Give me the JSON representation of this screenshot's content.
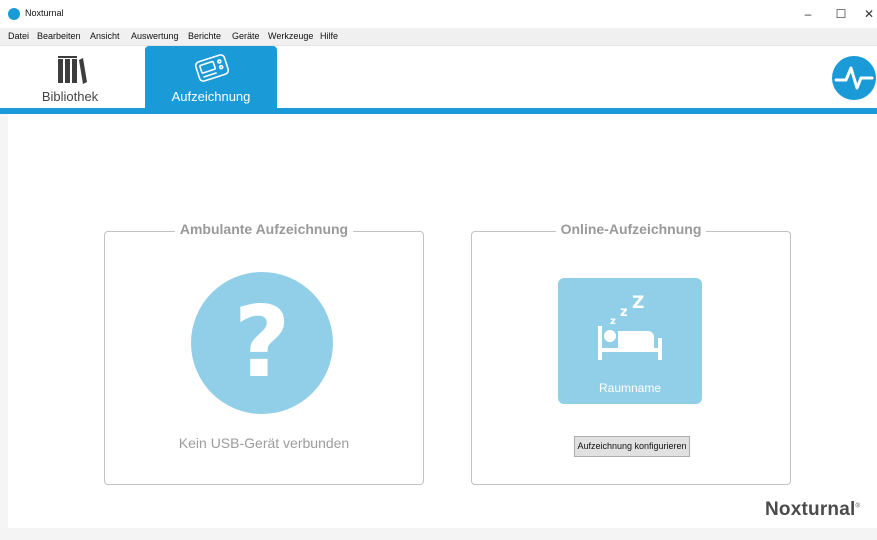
{
  "window": {
    "title": "Noxturnal",
    "minimize": "–",
    "maximize": "☐",
    "close": "✕"
  },
  "menu": [
    "Datei",
    "Bearbeiten",
    "Ansicht",
    "Auswertung",
    "Berichte",
    "Geräte",
    "Werkzeuge",
    "Hilfe"
  ],
  "tabs": {
    "library": "Bibliothek",
    "recording": "Aufzeichnung"
  },
  "ambulatory": {
    "title": "Ambulante Aufzeichnung",
    "symbol": "?",
    "status": "Kein USB-Gerät verbunden"
  },
  "online": {
    "title": "Online-Aufzeichnung",
    "room_name": "Raumname",
    "configure_button": "Aufzeichnung konfigurieren",
    "sleep_symbol": "zzZ"
  },
  "brand": {
    "name": "Noxturnal",
    "mark": "®"
  },
  "colors": {
    "accent": "#1a9ad6",
    "tile": "#91cfe8"
  },
  "icons": [
    "noxturnal-app-icon",
    "library-books-icon",
    "recorder-device-icon",
    "noxturnal-logo-icon",
    "question-mark-icon",
    "bed-sleep-icon"
  ]
}
